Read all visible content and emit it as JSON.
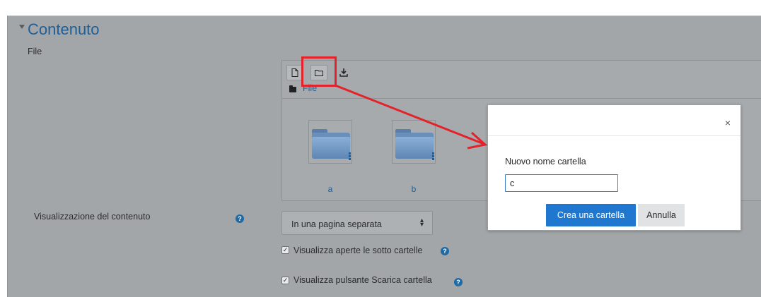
{
  "section": {
    "title": "Contenuto",
    "file_label": "File"
  },
  "file_manager": {
    "toolbar": [
      "add-file-icon",
      "create-folder-icon",
      "download-icon"
    ],
    "breadcrumb": "File",
    "folders": [
      {
        "name": "a"
      },
      {
        "name": "b"
      }
    ]
  },
  "display": {
    "label": "Visualizzazione del contenuto",
    "selected": "In una pagina separata",
    "help": "?"
  },
  "options": {
    "show_expanded_label": "Visualizza aperte le sotto cartelle",
    "show_download_label": "Visualizza pulsante Scarica cartella",
    "check_mark": "✓"
  },
  "dialog": {
    "close": "×",
    "label": "Nuovo nome cartella",
    "input_value": "c",
    "create_button": "Crea una cartella",
    "cancel_button": "Annulla"
  },
  "colors": {
    "accent": "#1f77d0",
    "link": "#1f5f98",
    "annotation": "#e3232c"
  }
}
